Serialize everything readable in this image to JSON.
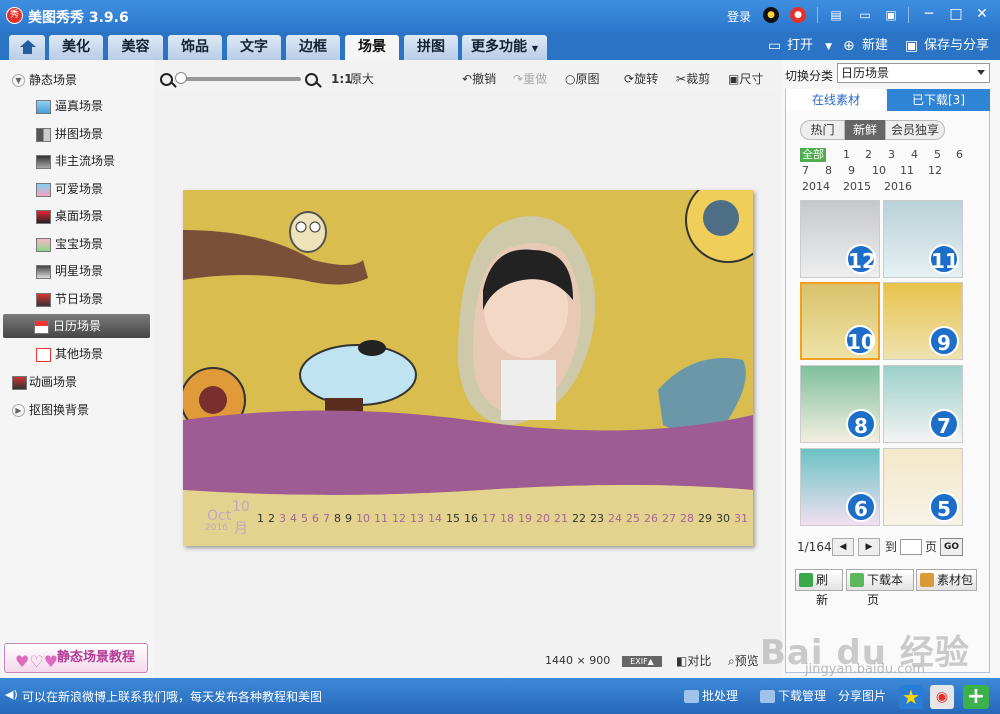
{
  "app": {
    "title": "美图秀秀 3.9.6",
    "logo_text": "秀",
    "login": "登录"
  },
  "tabs": [
    {
      "label": "美化"
    },
    {
      "label": "美容"
    },
    {
      "label": "饰品"
    },
    {
      "label": "文字"
    },
    {
      "label": "边框"
    },
    {
      "label": "场景"
    },
    {
      "label": "拼图"
    },
    {
      "label": "更多功能"
    }
  ],
  "toolbar_right": {
    "open": "打开",
    "new": "新建",
    "save_share": "保存与分享"
  },
  "sidebar": {
    "static_group": "静态场景",
    "items": [
      "逼真场景",
      "拼图场景",
      "非主流场景",
      "可爱场景",
      "桌面场景",
      "宝宝场景",
      "明星场景",
      "节日场景",
      "日历场景",
      "其他场景"
    ],
    "animated": "动画场景",
    "cutout": "抠图换背景",
    "tutorial": "静态场景教程"
  },
  "edit_tools": {
    "ratio": "1:1",
    "original_size": "原大",
    "undo": "撤销",
    "redo": "重做",
    "original": "原图",
    "rotate": "旋转",
    "crop": "裁剪",
    "size": "尺寸"
  },
  "image_info": {
    "width": "1440",
    "times": "×",
    "height": "900",
    "exif": "EXIF▲",
    "compare": "对比",
    "preview": "预览"
  },
  "calendar": {
    "month_en": "Oct",
    "year": "2016",
    "month_num": "10",
    "month_cn": "月",
    "days": [
      "1",
      "2",
      "3",
      "4",
      "5",
      "6",
      "7",
      "8",
      "9",
      "10",
      "11",
      "12",
      "13",
      "14",
      "15",
      "16",
      "17",
      "18",
      "19",
      "20",
      "21",
      "22",
      "23",
      "24",
      "25",
      "26",
      "27",
      "28",
      "29",
      "30",
      "31"
    ]
  },
  "right_panel": {
    "switch_label": "切换分类",
    "category": "日历场景",
    "tab_online": "在线素材",
    "tab_downloaded": "已下载[3]",
    "pills": [
      "热门",
      "新鲜",
      "会员独享"
    ],
    "filter_all": "全部",
    "months": [
      "1",
      "2",
      "3",
      "4",
      "5",
      "6",
      "7",
      "8",
      "9",
      "10",
      "11",
      "12"
    ],
    "years": [
      "2014",
      "2015",
      "2016"
    ],
    "thumbs": [
      "12",
      "11",
      "10",
      "9",
      "8",
      "7",
      "6",
      "5"
    ],
    "page": "1/164",
    "goto": "到",
    "page_unit": "页",
    "go": "GO",
    "refresh": "刷新",
    "download_page": "下载本页",
    "material_pack": "素材包"
  },
  "status": {
    "message": "可以在新浪微博上联系我们哦，每天发布各种教程和美图",
    "batch": "批处理",
    "download_mgr": "下载管理",
    "share": "分享图片"
  },
  "watermark": {
    "main": "Bai du 经验",
    "sub": "jingyan.baidu.com"
  }
}
